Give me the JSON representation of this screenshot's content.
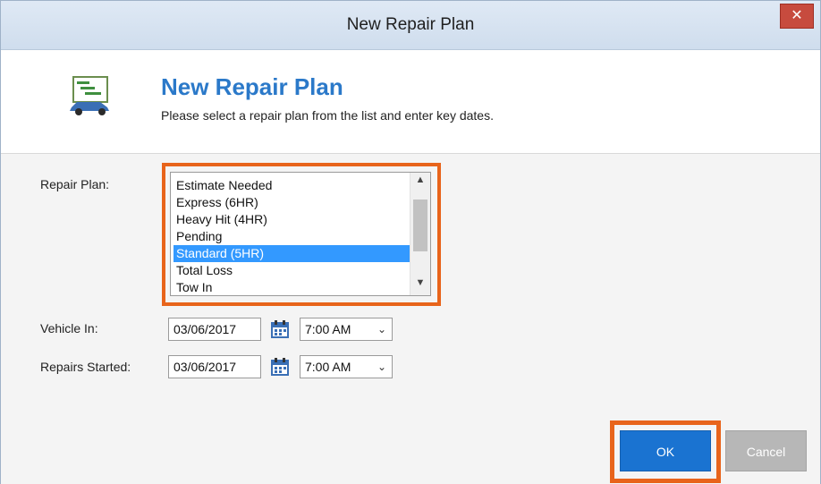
{
  "window": {
    "title": "New Repair Plan",
    "close_glyph": "✕"
  },
  "header": {
    "title": "New Repair Plan",
    "subtitle": "Please select a repair plan from the list and enter key dates.",
    "icon": "repair-plan-gantt-car-icon"
  },
  "form": {
    "repair_plan_label": "Repair Plan:",
    "repair_plans": [
      {
        "label": "Estimate Needed",
        "selected": false
      },
      {
        "label": "Express (6HR)",
        "selected": false
      },
      {
        "label": "Heavy Hit (4HR)",
        "selected": false
      },
      {
        "label": "Pending",
        "selected": false
      },
      {
        "label": "Standard (5HR)",
        "selected": true
      },
      {
        "label": "Total Loss",
        "selected": false
      },
      {
        "label": "Tow In",
        "selected": false
      }
    ],
    "vehicle_in_label": "Vehicle In:",
    "vehicle_in_date": "03/06/2017",
    "vehicle_in_time": "7:00 AM",
    "repairs_started_label": "Repairs Started:",
    "repairs_started_date": "03/06/2017",
    "repairs_started_time": "7:00 AM"
  },
  "buttons": {
    "ok": "OK",
    "cancel": "Cancel"
  },
  "colors": {
    "accent": "#2b79c9",
    "selection": "#3399ff",
    "highlight_box": "#e8641b",
    "ok_button": "#1a73d1",
    "cancel_button": "#b7b7b7",
    "close_button": "#c74b3e"
  }
}
